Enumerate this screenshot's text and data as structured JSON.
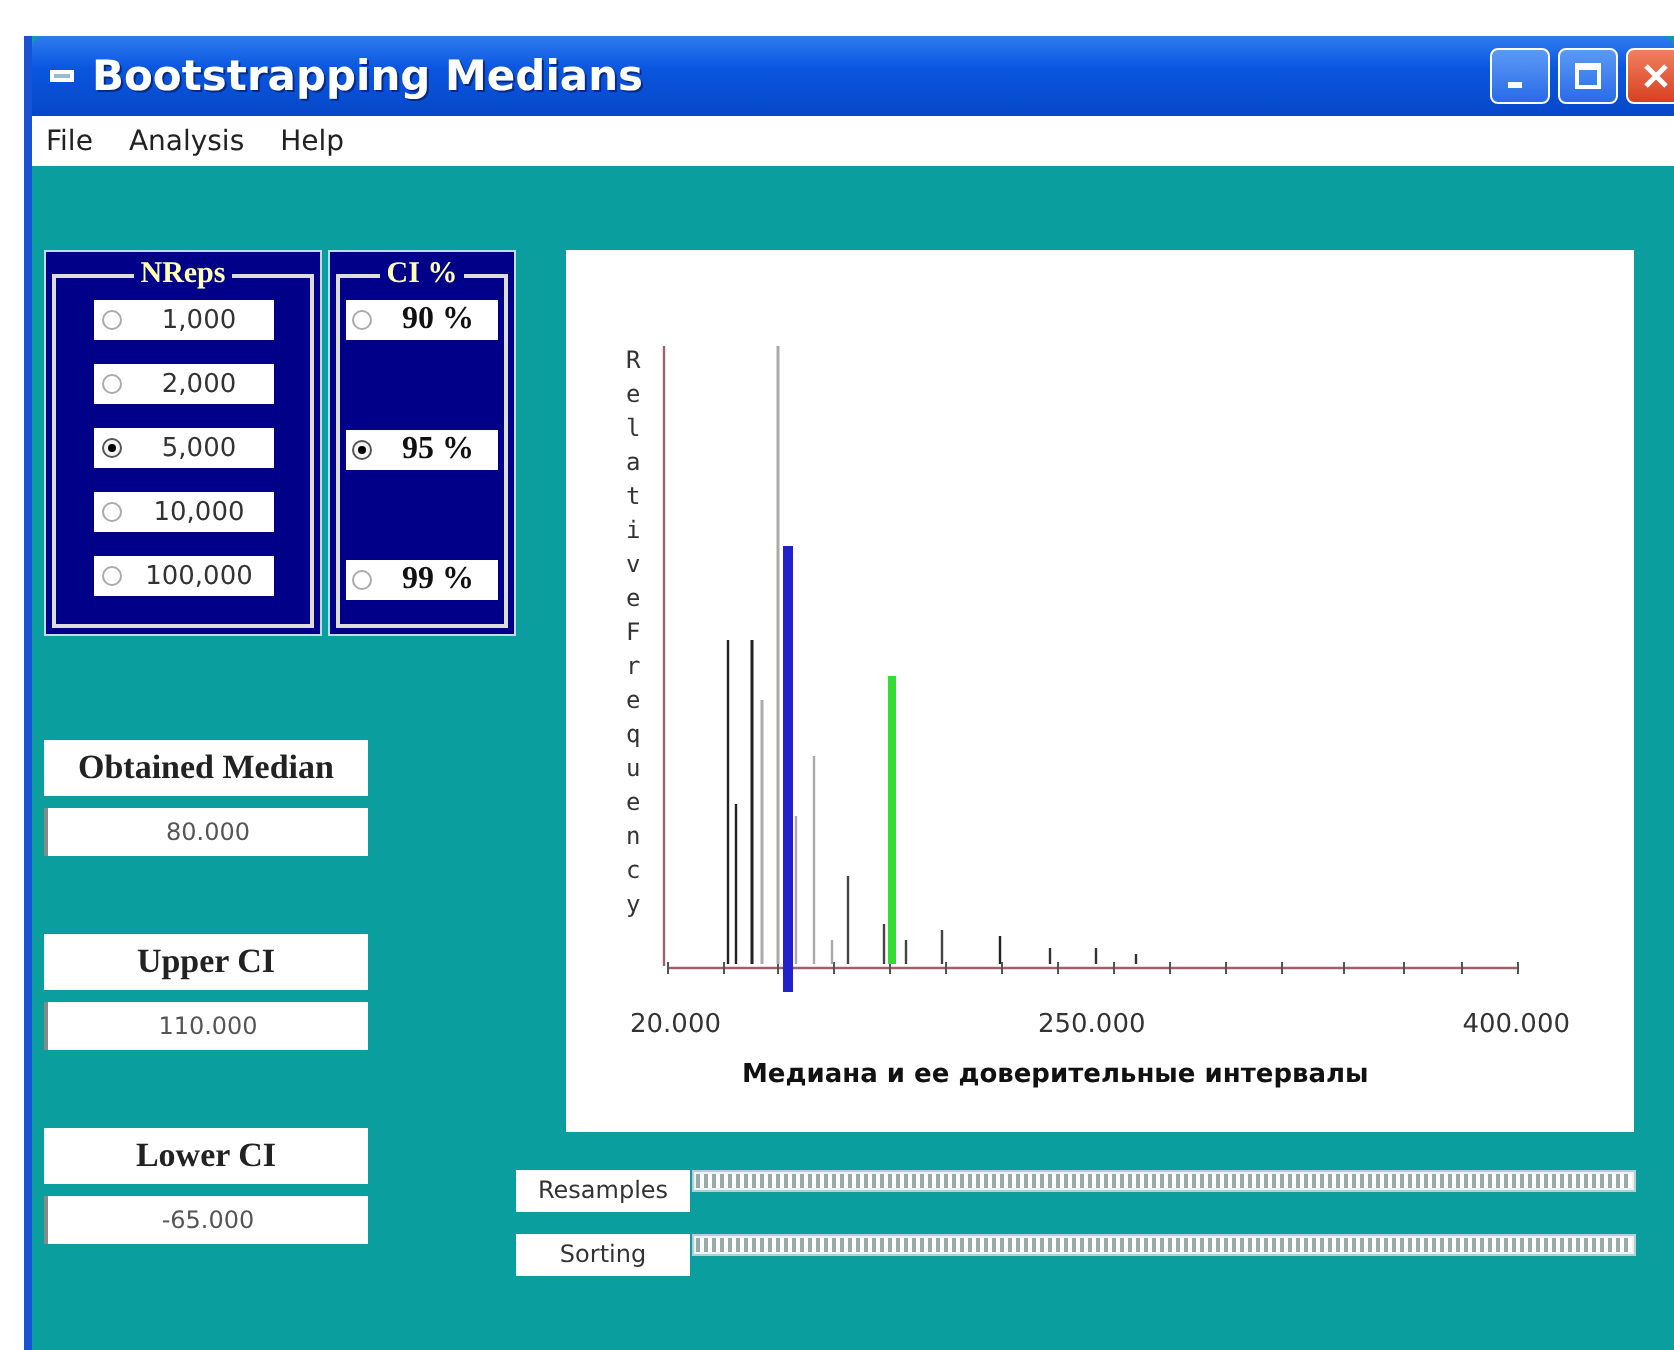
{
  "window": {
    "title": "Bootstrapping Medians"
  },
  "menu": [
    {
      "label": "File"
    },
    {
      "label": "Analysis"
    },
    {
      "label": "Help"
    }
  ],
  "nreps": {
    "title": "NReps",
    "options": [
      {
        "label": "1,000",
        "selected": false
      },
      {
        "label": "2,000",
        "selected": false
      },
      {
        "label": "5,000",
        "selected": true
      },
      {
        "label": "10,000",
        "selected": false
      },
      {
        "label": "100,000",
        "selected": false
      }
    ]
  },
  "ci": {
    "title": "CI %",
    "options": [
      {
        "label": "90 %",
        "selected": false
      },
      {
        "label": "95 %",
        "selected": true
      },
      {
        "label": "99 %",
        "selected": false
      }
    ]
  },
  "results": [
    {
      "label": "Obtained Median",
      "value": "80.000"
    },
    {
      "label": "Upper CI",
      "value": "110.000"
    },
    {
      "label": "Lower CI",
      "value": "-65.000"
    }
  ],
  "chart": {
    "ylabel": "Relative Frequency",
    "xticks": [
      "20.000",
      "250.000",
      "400.000"
    ],
    "xlabel": "Медиана и ее доверительные интервалы"
  },
  "progress": [
    {
      "label": "Resamples",
      "level": 1
    },
    {
      "label": "Sorting",
      "level": 1
    }
  ]
}
